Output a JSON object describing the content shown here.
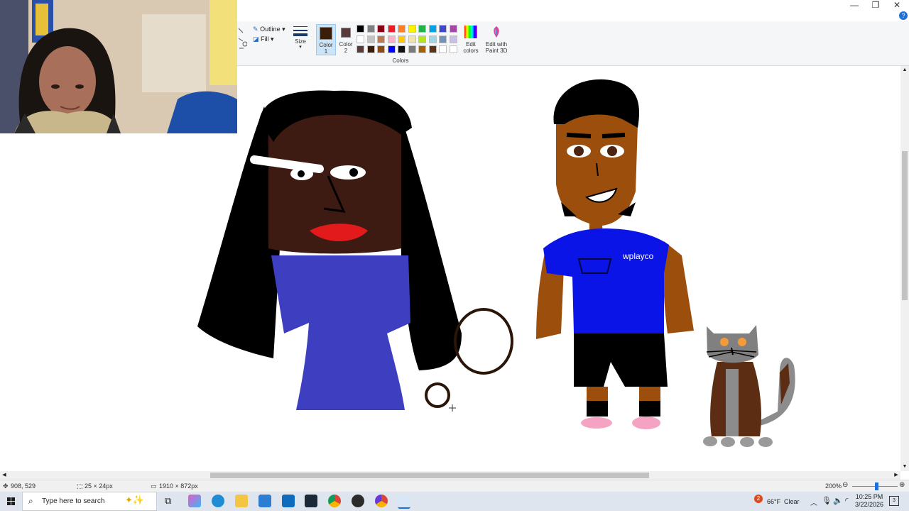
{
  "window": {
    "minimize_icon": "minimize-icon",
    "restore_icon": "restore-icon",
    "close_icon": "close-icon",
    "help_icon": "help-icon"
  },
  "ribbon": {
    "outline_label": "Outline",
    "fill_label": "Fill",
    "size_label": "Size",
    "color1_label": "Color",
    "color1_num": "1",
    "color2_label": "Color",
    "color2_num": "2",
    "color1_value": "#3b1e0a",
    "color2_value": "#5a3a3a",
    "edit_colors_line1": "Edit",
    "edit_colors_line2": "colors",
    "paint3d_line1": "Edit with",
    "paint3d_line2": "Paint 3D",
    "colors_group_label": "Colors",
    "palette_row1": [
      "#000000",
      "#7f7f7f",
      "#880015",
      "#ed1c24",
      "#ff7f27",
      "#fff200",
      "#22b14c",
      "#00a2e8",
      "#3f48cc",
      "#a349a4"
    ],
    "palette_row2": [
      "#ffffff",
      "#c3c3c3",
      "#b97a57",
      "#ffaec9",
      "#ffc90e",
      "#efe4b0",
      "#b5e61d",
      "#99d9ea",
      "#7092be",
      "#c8bfe7"
    ],
    "palette_row3": [
      "#5a3a3a",
      "#3b1e0a",
      "#8a4a14",
      "#0000ff",
      "#111111",
      "#7a7a7a",
      "#a0620a",
      "#5c3317",
      "#ffffff",
      "#ffffff"
    ]
  },
  "drawing": {
    "shirt_text": "wplayco"
  },
  "statusbar": {
    "cursor_pos": "908, 529",
    "selection_size": "25 × 24px",
    "canvas_size": "1910 × 872px",
    "zoom": "200%"
  },
  "taskbar": {
    "search_placeholder": "Type here to search",
    "weather_badge": "2",
    "weather_temp": "66°F",
    "weather_desc": "Clear",
    "time": "10:25 PM",
    "date": "3/22/2026",
    "notification_count": "3"
  }
}
